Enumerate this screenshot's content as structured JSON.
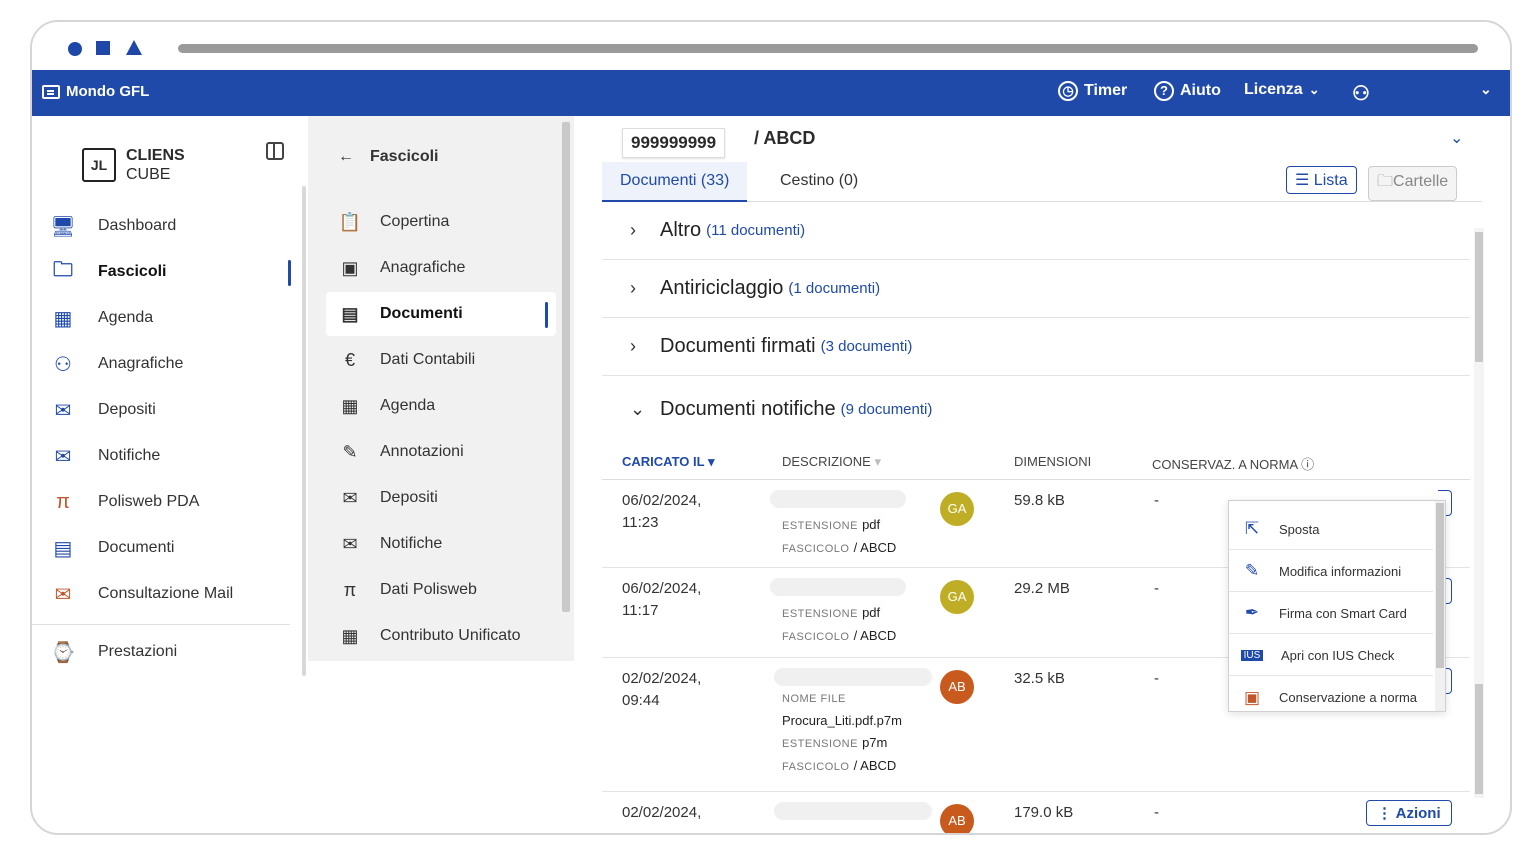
{
  "app": {
    "title": "Mondo GFL"
  },
  "topbar": {
    "timer": "Timer",
    "aiuto": "Aiuto",
    "licenza": "Licenza"
  },
  "logo": {
    "mark": "JL",
    "line1": "CLIENS",
    "line2": "CUBE"
  },
  "sidebar": {
    "items": [
      {
        "label": "Dashboard",
        "icon": "monitor-icon"
      },
      {
        "label": "Fascicoli",
        "icon": "folder-icon"
      },
      {
        "label": "Agenda",
        "icon": "calendar-icon"
      },
      {
        "label": "Anagrafiche",
        "icon": "people-icon"
      },
      {
        "label": "Depositi",
        "icon": "deposit-icon"
      },
      {
        "label": "Notifiche",
        "icon": "notification-icon"
      },
      {
        "label": "Polisweb PDA",
        "icon": "pi-icon"
      },
      {
        "label": "Documenti",
        "icon": "document-icon"
      },
      {
        "label": "Consultazione Mail",
        "icon": "mail-icon"
      },
      {
        "label": "Prestazioni",
        "icon": "briefcase-clock-icon"
      }
    ]
  },
  "panel2": {
    "title": "Fascicoli",
    "items": [
      {
        "label": "Copertina",
        "icon": "clipboard-icon"
      },
      {
        "label": "Anagrafiche",
        "icon": "contact-card-icon"
      },
      {
        "label": "Documenti",
        "icon": "document-icon"
      },
      {
        "label": "Dati Contabili",
        "icon": "euro-icon"
      },
      {
        "label": "Agenda",
        "icon": "calendar-icon"
      },
      {
        "label": "Annotazioni",
        "icon": "pencil-icon"
      },
      {
        "label": "Depositi",
        "icon": "deposit-icon"
      },
      {
        "label": "Notifiche",
        "icon": "notification-icon"
      },
      {
        "label": "Dati Polisweb",
        "icon": "pi-icon"
      },
      {
        "label": "Contributo Unificato",
        "icon": "calculator-icon"
      }
    ]
  },
  "main": {
    "fascicolo_number": "999999999",
    "fascicolo_name": "/ ABCD",
    "tabs": [
      "Documenti (33)",
      "Cestino (0)"
    ],
    "view_lista": "Lista",
    "view_cartelle": "Cartelle",
    "groups": [
      {
        "name": "Altro",
        "count": "(11 documenti)"
      },
      {
        "name": "Antiriciclaggio",
        "count": "(1 documenti)"
      },
      {
        "name": "Documenti firmati",
        "count": "(3 documenti)"
      },
      {
        "name": "Documenti notifiche",
        "count": "(9 documenti)"
      }
    ],
    "columns": {
      "caricato": "CARICATO IL",
      "descrizione": "DESCRIZIONE",
      "dimensioni": "DIMENSIONI",
      "conservaz": "CONSERVAZ. A NORMA"
    },
    "rows": [
      {
        "date": "06/02/2024,",
        "time": "11:23",
        "est_label": "ESTENSIONE",
        "est": "pdf",
        "fasc_label": "FASCICOLO",
        "fasc": "/ ABCD",
        "avatar": "GA",
        "size": "59.8 kB",
        "cons": "-"
      },
      {
        "date": "06/02/2024,",
        "time": "11:17",
        "est_label": "ESTENSIONE",
        "est": "pdf",
        "fasc_label": "FASCICOLO",
        "fasc": "/ ABCD",
        "avatar": "GA",
        "size": "29.2 MB",
        "cons": "-"
      },
      {
        "date": "02/02/2024,",
        "time": "09:44",
        "nome_label": "NOME FILE",
        "nome": "Procura_Liti.pdf.p7m",
        "est_label": "ESTENSIONE",
        "est": "p7m",
        "fasc_label": "FASCICOLO",
        "fasc": "/ ABCD",
        "avatar": "AB",
        "size": "32.5 kB",
        "cons": "-"
      },
      {
        "date": "02/02/2024,",
        "avatar": "AB",
        "size": "179.0 kB",
        "cons": "-",
        "azioni": "Azioni"
      }
    ],
    "menu": [
      {
        "label": "Sposta",
        "icon": "external-link-icon"
      },
      {
        "label": "Modifica informazioni",
        "icon": "pencil-icon"
      },
      {
        "label": "Firma con Smart Card",
        "icon": "pen-nib-icon"
      },
      {
        "label": "Apri con IUS Check",
        "icon": "ius-icon"
      },
      {
        "label": "Conservazione a norma",
        "icon": "archive-icon"
      }
    ]
  },
  "colors": {
    "brand": "#1f4aaa",
    "avatar_ga": "#bfae25",
    "avatar_ab": "#c95a1d"
  }
}
